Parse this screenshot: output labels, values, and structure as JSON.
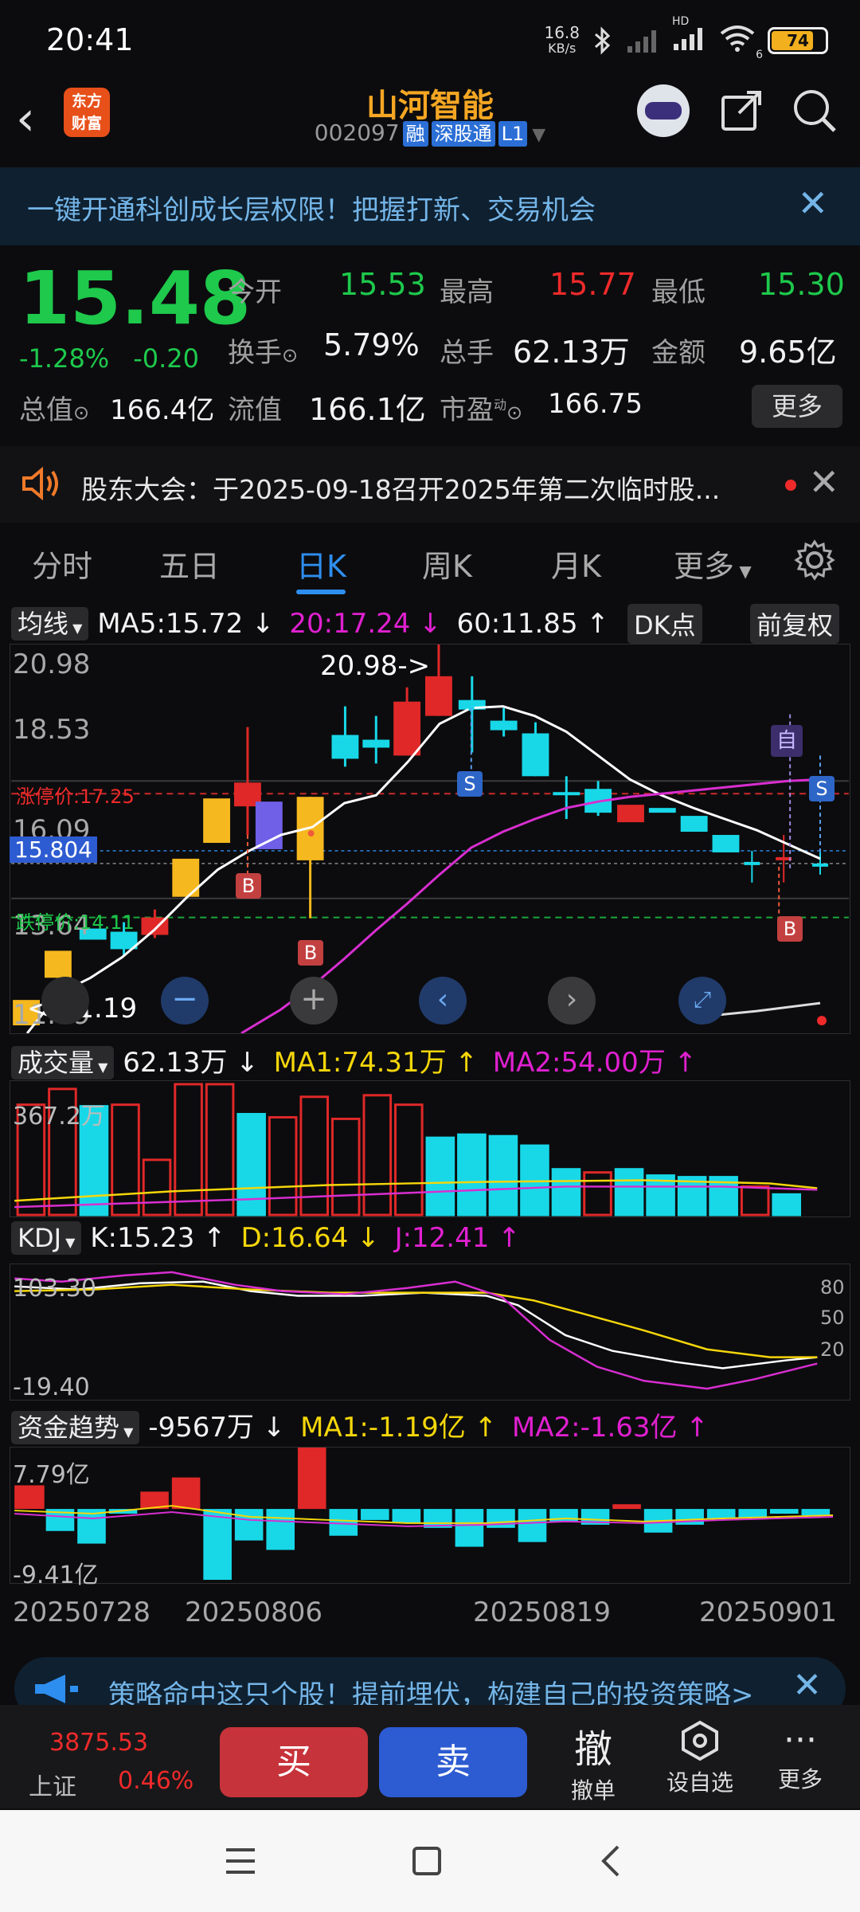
{
  "status": {
    "time": "20:41",
    "net_speed_top": "16.8",
    "net_speed_unit": "KB/s",
    "battery": "74",
    "hd": "HD",
    "sim": "6"
  },
  "header": {
    "logo": "东方财富",
    "title": "山河智能",
    "code": "002097",
    "tags": [
      "融",
      "深股通",
      "L1"
    ]
  },
  "banner": {
    "text": "一键开通科创成长层权限！把握打新、交易机会"
  },
  "quote": {
    "price": "15.48",
    "change_pct": "-1.28%",
    "change": "-0.20",
    "open_label": "今开",
    "open": "15.53",
    "high_label": "最高",
    "high": "15.77",
    "low_label": "最低",
    "low": "15.30",
    "turnover_label": "换手",
    "turnover": "5.79%",
    "volume_label": "总手",
    "volume": "62.13万",
    "amount_label": "金额",
    "amount": "9.65亿",
    "mktcap_label": "总值",
    "mktcap": "166.4亿",
    "float_label": "流值",
    "float": "166.1亿",
    "pe_label": "市盈",
    "pe_sup": "动",
    "pe": "166.75",
    "more": "更多"
  },
  "notice": {
    "text": "股东大会：于2025-09-18召开2025年第二次临时股..."
  },
  "tabs": [
    "分时",
    "五日",
    "日K",
    "周K",
    "月K",
    "更多"
  ],
  "active_tab": 2,
  "main_chart": {
    "indicator": "均线",
    "ma5": "MA5:15.72 ↓",
    "ma20": "20:17.24 ↓",
    "ma60": "60:11.85 ↑",
    "dk_button": "DK点",
    "fq_button": "前复权",
    "y_ticks": [
      "20.98",
      "18.53",
      "16.09",
      "13.64",
      "11.19"
    ],
    "limit_up": "涨停价:17.25",
    "limit_down": "跌停价:14.11",
    "current_line": "15.804",
    "annot_high": "20.98->",
    "annot_low": "<-11.19",
    "marker_self": "自",
    "marker_s": "S",
    "marker_b": "B"
  },
  "volume": {
    "indicator": "成交量",
    "value": "62.13万 ↓",
    "ma1": "MA1:74.31万 ↑",
    "ma2": "MA2:54.00万 ↑",
    "y_max": "367.2万"
  },
  "kdj": {
    "indicator": "KDJ",
    "k": "K:15.23 ↑",
    "d": "D:16.64 ↓",
    "j": "J:12.41 ↑",
    "y_top": "103.30",
    "y_bottom": "-19.40",
    "r80": "80",
    "r50": "50",
    "r20": "20"
  },
  "fund": {
    "indicator": "资金趋势",
    "value": "-9567万 ↓",
    "ma1": "MA1:-1.19亿 ↑",
    "ma2": "MA2:-1.63亿 ↑",
    "y_top": "7.79亿",
    "y_bottom": "-9.41亿"
  },
  "x_dates": [
    "20250728",
    "20250806",
    "20250819",
    "20250901"
  ],
  "ad": {
    "text": "策略命中这只个股！提前埋伏，构建自己的投资策略>"
  },
  "bottom": {
    "index_value": "3875.53",
    "index_name": "上证",
    "index_change": "0.46%",
    "buy": "买",
    "sell": "卖",
    "cancel_icon": "撤",
    "cancel": "撤单",
    "watch": "设自选",
    "more": "更多"
  },
  "colors": {
    "up": "#ef2a2a",
    "down": "#1ec94c",
    "accent": "#2e8ef0",
    "brand": "#f5a623"
  }
}
